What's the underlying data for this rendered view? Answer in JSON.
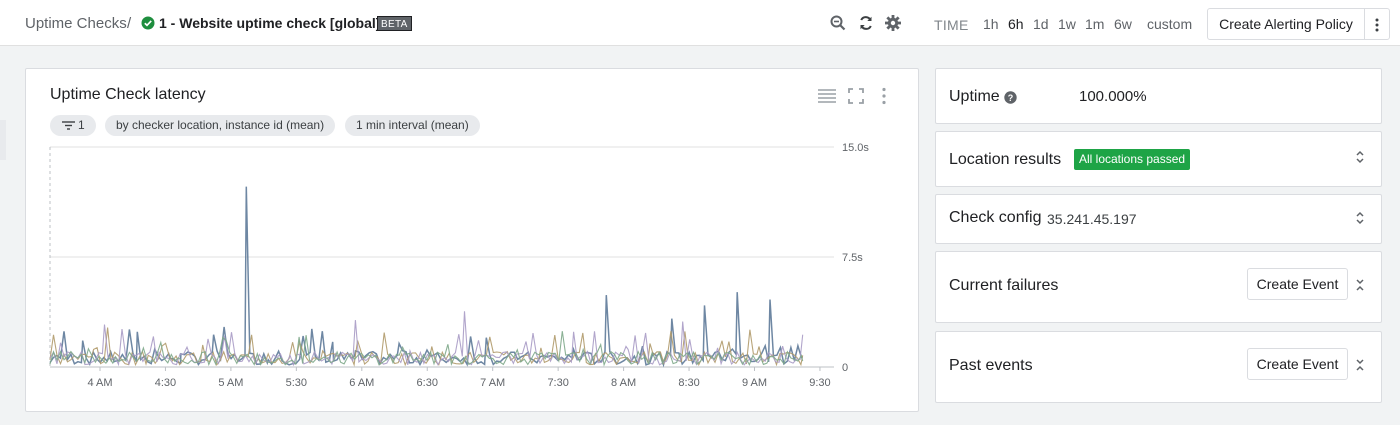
{
  "header": {
    "breadcrumb_root": "Uptime Checks",
    "breadcrumb_sep": "/",
    "check_title": "1 - Website uptime check [global]",
    "beta_badge": "BETA",
    "status_icon": "check-circle-icon",
    "icons": [
      "zoom-out-icon",
      "refresh-icon",
      "gear-icon"
    ],
    "time_label": "TIME",
    "ranges": [
      "1h",
      "6h",
      "1d",
      "1w",
      "1m",
      "6w",
      "custom"
    ],
    "selected_range": "6h",
    "create_alerting_policy": "Create Alerting Policy",
    "more_icon": "more-vert-icon"
  },
  "chart": {
    "title": "Uptime Check latency",
    "filter_count": "1",
    "group_chip": "by checker location, instance id (mean)",
    "interval_chip": "1 min interval (mean)",
    "icons": [
      "legend-icon",
      "fullscreen-icon",
      "more-vert-icon"
    ]
  },
  "chart_data": {
    "type": "line",
    "title": "Uptime Check latency",
    "x_ticks": [
      "4 AM",
      "4:30",
      "5 AM",
      "5:30",
      "6 AM",
      "6:30",
      "7 AM",
      "7:30",
      "8 AM",
      "8:30",
      "9 AM",
      "9:30"
    ],
    "y_ticks": [
      "15.0s",
      "7.5s",
      "0"
    ],
    "ylim": [
      0,
      15.0
    ],
    "y_unit": "s",
    "grid": true,
    "series_colors": [
      "#5e7a99",
      "#b09a6a",
      "#a99bc5",
      "#7ea88a",
      "#c2a27a"
    ],
    "series": [
      {
        "x_minutes": [
          0,
          15,
          30,
          40,
          55,
          60,
          75,
          90,
          100,
          120,
          130,
          140,
          160,
          180,
          200,
          220,
          240,
          255,
          270,
          285,
          300,
          315,
          330,
          345
        ],
        "values": [
          0.3,
          1.8,
          0.4,
          2.4,
          0.6,
          0.9,
          2.2,
          12.3,
          0.5,
          2.6,
          0.4,
          1.1,
          1.6,
          0.5,
          2.0,
          0.6,
          1.2,
          4.9,
          0.4,
          3.3,
          4.2,
          5.1,
          4.6,
          0.7
        ]
      },
      {
        "x_minutes": [
          0,
          20,
          45,
          70,
          100,
          125,
          150,
          175,
          200,
          225,
          250,
          275,
          300,
          325,
          345
        ],
        "values": [
          0.5,
          1.2,
          0.8,
          1.5,
          0.9,
          1.1,
          0.7,
          1.4,
          0.8,
          1.3,
          0.9,
          1.6,
          1.0,
          1.4,
          0.8
        ]
      },
      {
        "x_minutes": [
          0,
          25,
          50,
          80,
          110,
          140,
          165,
          190,
          215,
          240,
          265,
          290,
          315,
          345
        ],
        "values": [
          0.6,
          2.9,
          1.0,
          2.1,
          0.8,
          3.2,
          1.1,
          3.8,
          0.9,
          2.4,
          1.2,
          3.1,
          1.0,
          2.2
        ]
      },
      {
        "x_minutes": [
          0,
          30,
          60,
          95,
          130,
          160,
          195,
          230,
          260,
          295,
          330,
          345
        ],
        "values": [
          0.2,
          0.7,
          0.5,
          0.9,
          0.4,
          0.8,
          0.6,
          0.9,
          0.5,
          1.0,
          0.7,
          0.4
        ]
      }
    ]
  },
  "panels": {
    "uptime_label": "Uptime",
    "uptime_value": "100.000%",
    "location_label": "Location results",
    "location_badge": "All locations passed",
    "config_label": "Check config",
    "config_value": "35.241.45.197",
    "failures_label": "Current failures",
    "past_label": "Past events",
    "create_event": "Create Event",
    "badge_color": "#1ea446"
  }
}
